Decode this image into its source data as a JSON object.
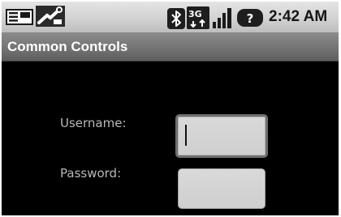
{
  "status_bar": {
    "time": "2:42 AM",
    "icons": [
      "notification-icon",
      "wrench-icon",
      "bluetooth-icon",
      "network-3g-icon",
      "signal-icon",
      "question-icon"
    ]
  },
  "app": {
    "title": "Common Controls"
  },
  "form": {
    "username_label": "Username:",
    "username_value": "",
    "password_label": "Password:",
    "password_value": ""
  },
  "colors": {
    "background": "#000000",
    "title_bar": "#767676",
    "status_bar": "#d2d2d2",
    "label_text": "#b8b8b8",
    "field_fill": "#d4d4d4"
  }
}
